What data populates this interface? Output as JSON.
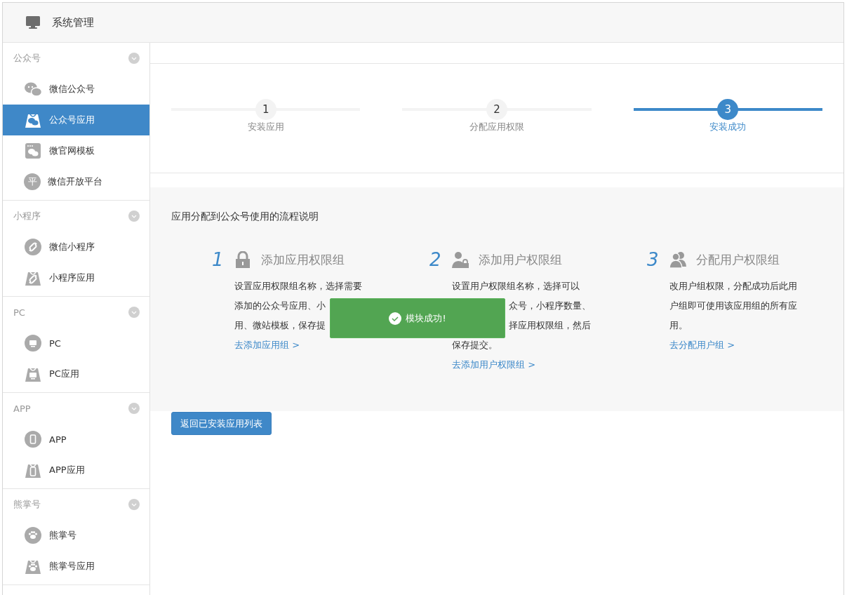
{
  "header": {
    "title": "系统管理"
  },
  "sidebar": {
    "groups": [
      {
        "label": "公众号",
        "expanded": true,
        "items": [
          {
            "label": "微信公众号",
            "selected": false,
            "kind": "chat"
          },
          {
            "label": "公众号应用",
            "selected": true,
            "kind": "chatbag"
          },
          {
            "label": "微官网模板",
            "selected": false,
            "kind": "template"
          },
          {
            "label": "微信开放平台",
            "selected": false,
            "kind": "letter",
            "letter": "平"
          }
        ]
      },
      {
        "label": "小程序",
        "expanded": true,
        "items": [
          {
            "label": "微信小程序",
            "selected": false,
            "kind": "link"
          },
          {
            "label": "小程序应用",
            "selected": false,
            "kind": "linkbag"
          }
        ]
      },
      {
        "label": "PC",
        "expanded": true,
        "items": [
          {
            "label": "PC",
            "selected": false,
            "kind": "monitor"
          },
          {
            "label": "PC应用",
            "selected": false,
            "kind": "monitorbag"
          }
        ]
      },
      {
        "label": "APP",
        "expanded": true,
        "items": [
          {
            "label": "APP",
            "selected": false,
            "kind": "phone"
          },
          {
            "label": "APP应用",
            "selected": false,
            "kind": "phonebag"
          }
        ]
      },
      {
        "label": "熊掌号",
        "expanded": true,
        "items": [
          {
            "label": "熊掌号",
            "selected": false,
            "kind": "paw"
          },
          {
            "label": "熊掌号应用",
            "selected": false,
            "kind": "pawbag"
          }
        ]
      }
    ]
  },
  "steps": [
    {
      "number": "1",
      "label": "安装应用",
      "active": false
    },
    {
      "number": "2",
      "label": "分配应用权限",
      "active": false
    },
    {
      "number": "3",
      "label": "安装成功",
      "active": true
    }
  ],
  "guide": {
    "title": "应用分配到公众号使用的流程说明",
    "items": [
      {
        "number": "1",
        "kind": "lock",
        "title": "添加应用权限组",
        "lines": [
          {
            "text": "设置应用权限组名称，选择需要",
            "kind": "start"
          },
          {
            "text": "添加的公众号应用、小",
            "kind": "start"
          },
          {
            "text": "用、微站模板，保存提",
            "kind": "start"
          }
        ],
        "link": "去添加应用组 >"
      },
      {
        "number": "2",
        "kind": "userlock",
        "title": "添加用户权限组",
        "lines": [
          {
            "text": "设置用户权限组名称，选择可以",
            "kind": "start"
          },
          {
            "text": "众号，小程序数量、",
            "kind": "end"
          },
          {
            "text": "择应用权限组，然后",
            "kind": "end"
          },
          {
            "text": "保存提交。",
            "kind": "start"
          }
        ],
        "link": "去添加用户权限组 >"
      },
      {
        "number": "3",
        "kind": "users",
        "title": "分配用户权限组",
        "lines": [
          {
            "text": "改用户组权限，分配成功后此用",
            "kind": "start"
          },
          {
            "text": "户组即可使用该应用组的所有应",
            "kind": "start"
          },
          {
            "text": "用。",
            "kind": "start"
          }
        ],
        "link": "去分配用户组 >"
      }
    ]
  },
  "back_button": "返回已安装应用列表",
  "toast": {
    "message": "模块成功!"
  }
}
